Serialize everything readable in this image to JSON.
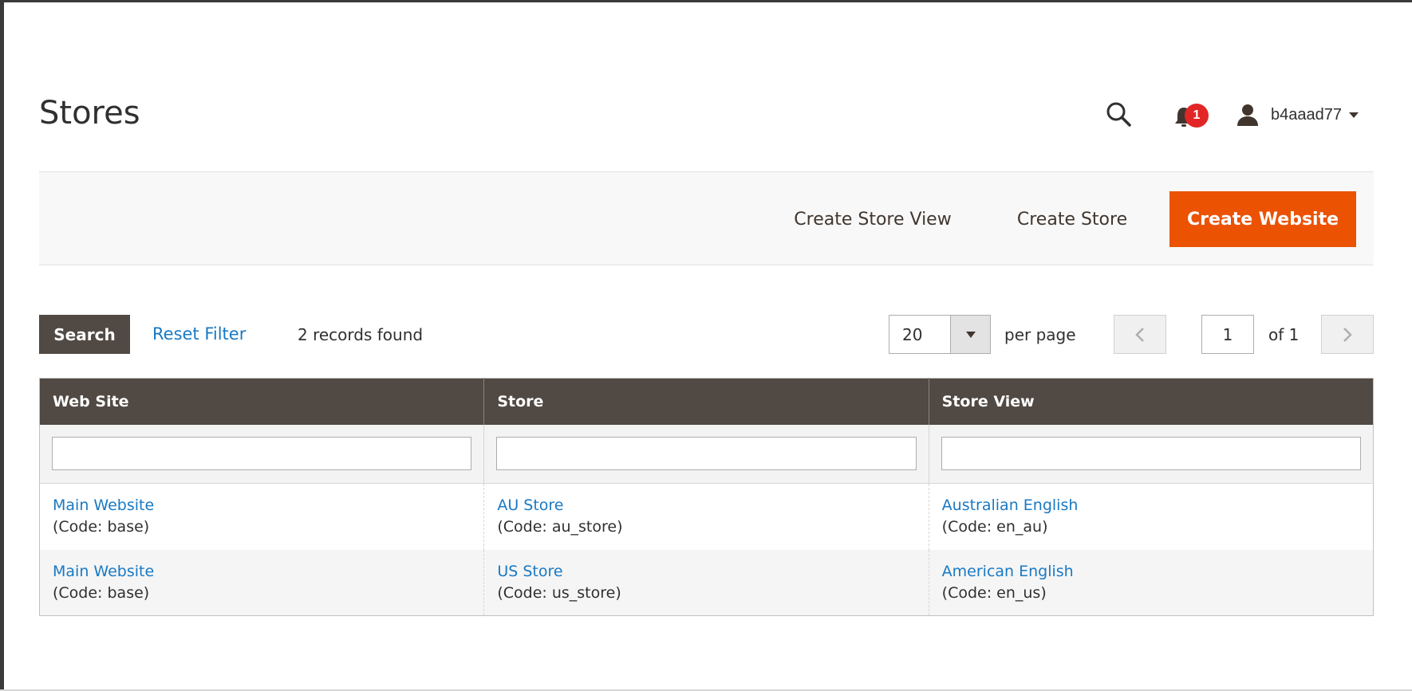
{
  "page": {
    "title": "Stores"
  },
  "header": {
    "notification_count": "1",
    "username": "b4aaad77",
    "icons": [
      "search-icon",
      "bell-icon",
      "user-icon",
      "chevron-down-icon"
    ]
  },
  "toolbar": {
    "create_store_view": "Create Store View",
    "create_store": "Create Store",
    "create_website": "Create Website"
  },
  "grid": {
    "search_label": "Search",
    "reset_label": "Reset Filter",
    "records_found": "2 records found",
    "per_page_value": "20",
    "per_page_label": "per page",
    "current_page": "1",
    "page_of": "of 1",
    "columns": [
      "Web Site",
      "Store",
      "Store View"
    ],
    "rows": [
      {
        "website": "Main Website",
        "website_code": "(Code: base)",
        "store": "AU Store",
        "store_code": "(Code: au_store)",
        "view": "Australian English",
        "view_code": "(Code: en_au)"
      },
      {
        "website": "Main Website",
        "website_code": "(Code: base)",
        "store": "US Store",
        "store_code": "(Code: us_store)",
        "view": "American English",
        "view_code": "(Code: en_us)"
      }
    ]
  },
  "colors": {
    "primary": "#eb5202",
    "header_bg": "#514943",
    "link": "#1979c3",
    "badge": "#e22626"
  }
}
